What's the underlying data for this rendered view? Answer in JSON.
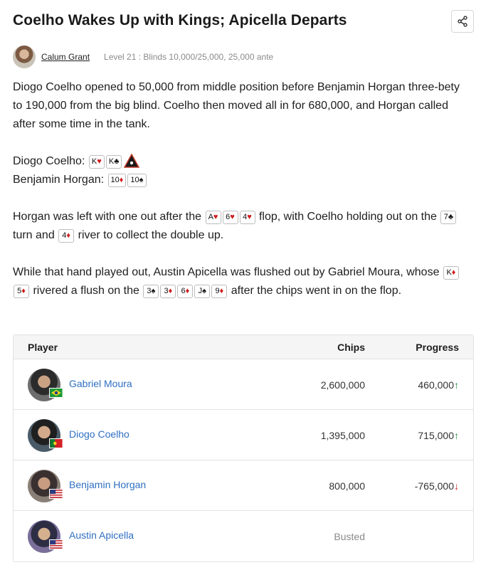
{
  "article": {
    "title": "Coelho Wakes Up with Kings; Apicella Departs",
    "author": "Calum Grant",
    "level": "Level 21 : Blinds 10,000/25,000, 25,000 ante",
    "share_icon": "share-icon",
    "p1": "Diogo Coelho opened to 50,000 from middle position before Benjamin Horgan three-bety to 190,000 from the big blind. Coelho then moved all in for 680,000, and Horgan called after some time in the tank.",
    "hand1_player": "Diogo Coelho:",
    "hand2_player": "Benjamin Horgan:",
    "p3_a": "Horgan was left with one out after the",
    "p3_b": "flop, with Coelho holding out on the",
    "p3_c": "turn and",
    "p3_d": "river to collect the double up.",
    "p4_a": "While that hand played out, Austin Apicella was flushed out by Gabriel Moura, whose",
    "p4_b": "rivered a flush on the",
    "p4_c": "after the chips went in on the flop."
  },
  "cards": {
    "coelho": [
      {
        "rank": "K",
        "suit": "♥",
        "red": true
      },
      {
        "rank": "K",
        "suit": "♣",
        "red": false
      }
    ],
    "horgan": [
      {
        "rank": "10",
        "suit": "♦",
        "red": true
      },
      {
        "rank": "10",
        "suit": "♠",
        "red": false
      }
    ],
    "flop": [
      {
        "rank": "A",
        "suit": "♥",
        "red": true
      },
      {
        "rank": "6",
        "suit": "♥",
        "red": true
      },
      {
        "rank": "4",
        "suit": "♥",
        "red": true
      }
    ],
    "turn": {
      "rank": "7",
      "suit": "♣",
      "red": false
    },
    "river": {
      "rank": "4",
      "suit": "♦",
      "red": true
    },
    "moura": [
      {
        "rank": "K",
        "suit": "♦",
        "red": true
      },
      {
        "rank": "5",
        "suit": "♦",
        "red": true
      }
    ],
    "board2": [
      {
        "rank": "3",
        "suit": "♠",
        "red": false
      },
      {
        "rank": "3",
        "suit": "♦",
        "red": true
      },
      {
        "rank": "6",
        "suit": "♦",
        "red": true
      },
      {
        "rank": "J",
        "suit": "♠",
        "red": false
      },
      {
        "rank": "9",
        "suit": "♦",
        "red": true
      }
    ]
  },
  "table": {
    "headers": {
      "player": "Player",
      "chips": "Chips",
      "progress": "Progress"
    },
    "rows": [
      {
        "name": "Gabriel Moura",
        "chips": "2,600,000",
        "progress": "460,000",
        "trend": "↑",
        "flag": "brazil-flag"
      },
      {
        "name": "Diogo Coelho",
        "chips": "1,395,000",
        "progress": "715,000",
        "trend": "↑",
        "flag": "portugal-flag"
      },
      {
        "name": "Benjamin Horgan",
        "chips": "800,000",
        "progress": "-765,000",
        "trend": "↓",
        "flag": "usa-flag"
      },
      {
        "name": "Austin Apicella",
        "chips": "Busted",
        "progress": "",
        "trend": "",
        "flag": "usa-flag"
      }
    ]
  },
  "colors": {
    "link": "#2f6fc2",
    "up": "#1c8a3a",
    "down": "#d11c1c",
    "red_suit": "#d11c1c"
  }
}
